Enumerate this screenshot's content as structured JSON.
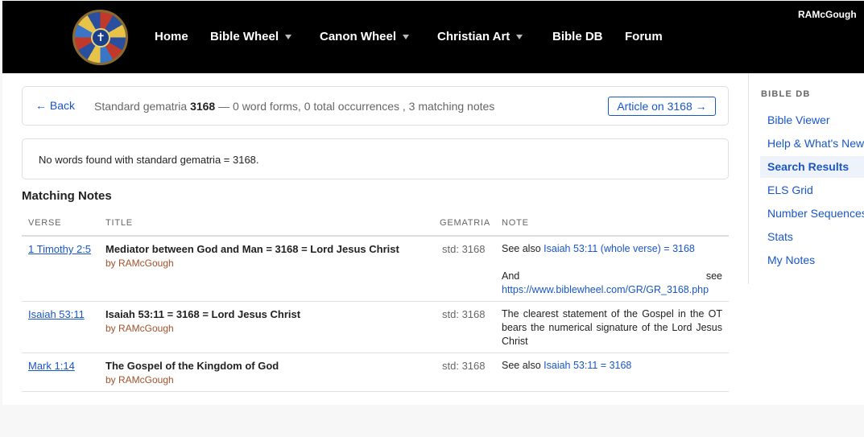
{
  "header": {
    "logo_icon": "cross-wheel-logo",
    "nav": [
      {
        "label": "Home",
        "has_dropdown": false
      },
      {
        "label": "Bible Wheel",
        "has_dropdown": true
      },
      {
        "label": "Canon Wheel",
        "has_dropdown": true
      },
      {
        "label": "Christian Art",
        "has_dropdown": true
      },
      {
        "label": "Bible DB",
        "has_dropdown": false
      },
      {
        "label": "Forum",
        "has_dropdown": false
      }
    ],
    "user": "RAMcGough"
  },
  "summary": {
    "back_label": "← Back",
    "prefix": "Standard gematria",
    "value": "3168",
    "suffix": "— 0 word forms, 0 total occurrences , 3 matching notes",
    "article_button": "Article on 3168 →"
  },
  "no_words": "No words found with standard gematria = 3168.",
  "notes": {
    "heading": "Matching Notes",
    "columns": [
      "VERSE",
      "TITLE",
      "GEMATRIA",
      "NOTE"
    ],
    "rows": [
      {
        "verse": "1 Timothy 2:5",
        "title": "Mediator between God and Man = 3168 = Lord Jesus Christ",
        "author": "by RAMcGough",
        "gematria": "std: 3168",
        "note_pre": "See also",
        "note_link": "Isaiah 53:11 (whole verse) = 3168",
        "note2_a": "And",
        "note2_b": "see",
        "note2_link": "https://www.biblewheel.com/GR/GR_3168.php"
      },
      {
        "verse": "Isaiah 53:11",
        "title": "Isaiah 53:11 = 3168 = Lord Jesus Christ",
        "author": "by RAMcGough",
        "gematria": "std: 3168",
        "note": "The clearest statement of the Gospel in the OT bears the numerical signature of the Lord Jesus Christ"
      },
      {
        "verse": "Mark 1:14",
        "title": "The Gospel of the Kingdom of God",
        "author": "by RAMcGough",
        "gematria": "std: 3168",
        "note_pre": "See also",
        "note_link": "Isaiah 53:11 = 3168"
      }
    ]
  },
  "sidebar": {
    "heading": "BIBLE DB",
    "items": [
      "Bible Viewer",
      "Help & What's New",
      "Search Results",
      "ELS Grid",
      "Number Sequences",
      "Stats",
      "My Notes"
    ],
    "active": "Search Results"
  }
}
